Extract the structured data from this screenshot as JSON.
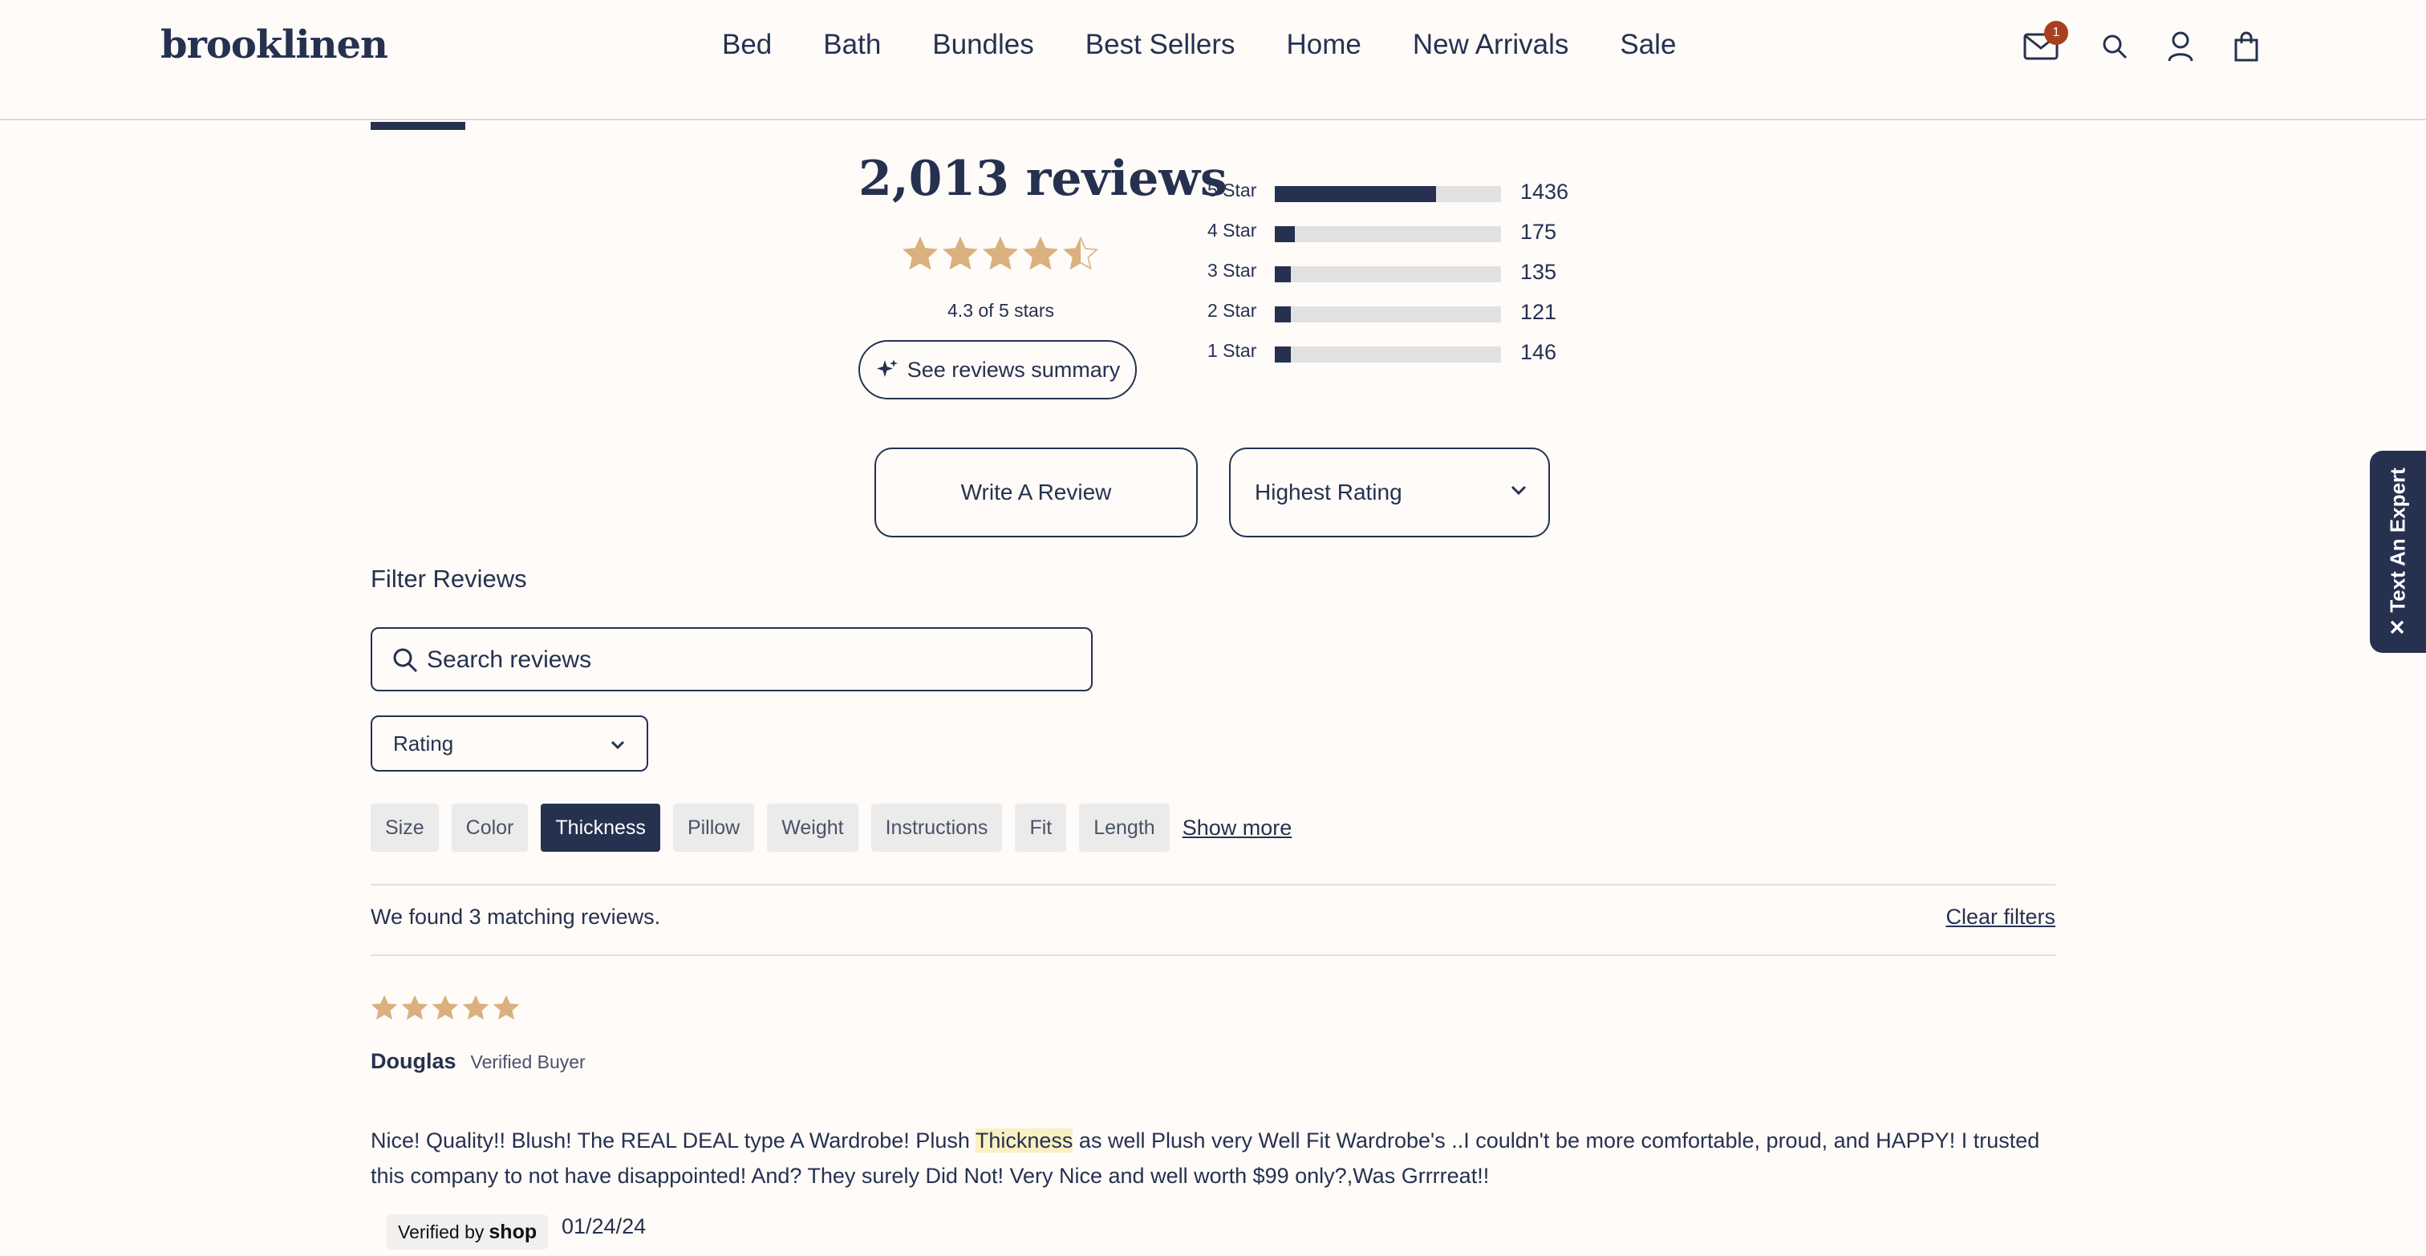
{
  "header": {
    "logo": "brooklinen",
    "nav": [
      "Bed",
      "Bath",
      "Bundles",
      "Best Sellers",
      "Home",
      "New Arrivals",
      "Sale"
    ],
    "mail_badge": "1"
  },
  "summary": {
    "review_count": "2,013 reviews",
    "average_rating": 4.3,
    "average_text": "4.3 of 5 stars",
    "summary_button": "See reviews summary",
    "histogram": [
      {
        "label": "5 Star",
        "count": 1436
      },
      {
        "label": "4 Star",
        "count": 175
      },
      {
        "label": "3 Star",
        "count": 135
      },
      {
        "label": "2 Star",
        "count": 121
      },
      {
        "label": "1 Star",
        "count": 146
      }
    ],
    "write_button": "Write A Review",
    "sort_value": "Highest Rating"
  },
  "filters": {
    "title": "Filter Reviews",
    "search_placeholder": "Search reviews",
    "rating_select": "Rating",
    "chips": [
      {
        "label": "Size",
        "active": false
      },
      {
        "label": "Color",
        "active": false
      },
      {
        "label": "Thickness",
        "active": true
      },
      {
        "label": "Pillow",
        "active": false
      },
      {
        "label": "Weight",
        "active": false
      },
      {
        "label": "Instructions",
        "active": false
      },
      {
        "label": "Fit",
        "active": false
      },
      {
        "label": "Length",
        "active": false
      }
    ],
    "show_more": "Show more",
    "found_text": "We found 3 matching reviews.",
    "clear_filters": "Clear filters"
  },
  "review": {
    "rating": 5,
    "name": "Douglas",
    "verified": "Verified Buyer",
    "body_before": "Nice! Quality!! Blush! The REAL DEAL type A Wardrobe! Plush ",
    "body_highlight": "Thickness",
    "body_after": " as well Plush very Well Fit Wardrobe's ..I couldn't be more comfortable, proud, and HAPPY! I trusted this company to not have disappointed! And? They surely Did Not! Very Nice and well worth $99 only?,Was Grrrreat!!",
    "shop_prefix": "Verified by",
    "shop_word": "shop",
    "date": "01/24/24"
  },
  "side_widget": {
    "label": "Text An Expert",
    "close_glyph": "✕"
  },
  "colors": {
    "navy": "#263150",
    "star": "#d9b07e",
    "background": "#fffbf8",
    "badge": "#a8401f"
  }
}
